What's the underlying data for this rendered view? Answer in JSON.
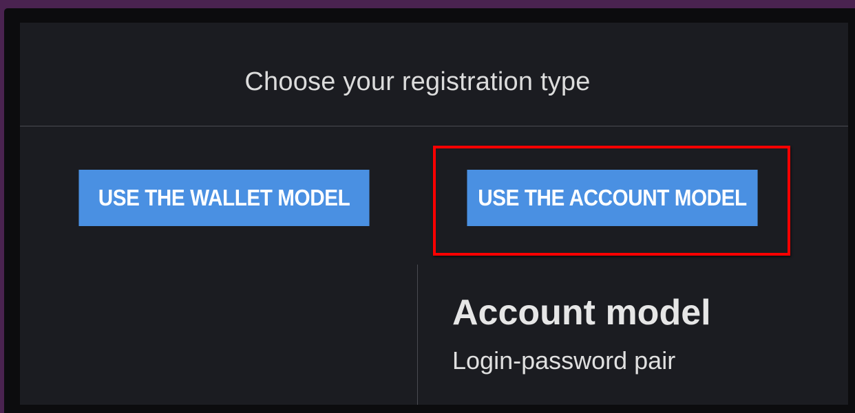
{
  "dialog": {
    "title": "Choose your registration type"
  },
  "buttons": {
    "wallet_label": "USE THE WALLET MODEL",
    "account_label": "USE THE ACCOUNT MODEL"
  },
  "account_model": {
    "heading": "Account model",
    "subtitle": "Login-password pair"
  },
  "colors": {
    "background_outer": "#4a2350",
    "panel": "#1b1c21",
    "button": "#4a90e2",
    "highlight": "#ff0000"
  }
}
